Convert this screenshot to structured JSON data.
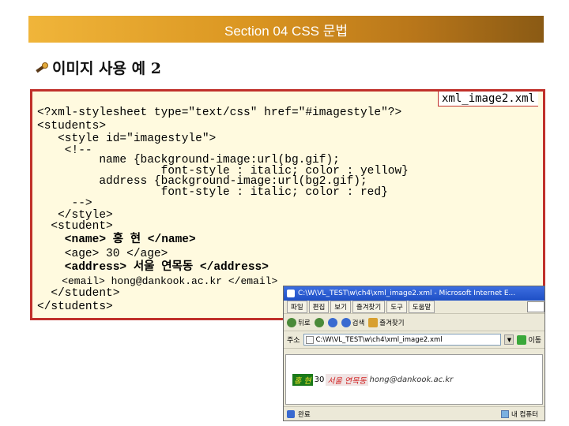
{
  "header": {
    "title": "Section 04 CSS 문법"
  },
  "slide": {
    "heading": "이미지 사용 예 2"
  },
  "code": {
    "filename": "xml_image2.xml",
    "lines": [
      "<?xml-stylesheet type=\"text/css\" href=\"#imagestyle\"?>",
      "<students>",
      "   <style id=\"imagestyle\">",
      "    <!--",
      "         name {background-image:url(bg.gif);",
      "                  font-style : italic; color : yellow}",
      "         address {background-image:url(bg2.gif);",
      "                  font-style : italic; color : red}",
      "     -->",
      "   </style>",
      "  <student>",
      "    <name> 홍 현 </name>",
      "    <age> 30 </age>",
      "    <address> 서울 연목동 </address>",
      "    <email> hong@dankook.ac.kr </email>",
      "  </student>",
      "</students>"
    ]
  },
  "browser": {
    "title": "C:\\W\\VL_TEST\\w\\ch4\\xml_image2.xml - Microsoft Internet E...",
    "menu": [
      "파일",
      "편집",
      "보기",
      "즐겨찾기",
      "도구",
      "도움말"
    ],
    "toolbar": [
      "뒤로",
      "검색",
      "즐겨찾기"
    ],
    "address_label": "주소",
    "address_value": "C:\\W\\VL_TEST\\w\\ch4\\xml_image2.xml",
    "go_label": "이동",
    "render": {
      "name": "홍 현",
      "age": "30",
      "address": "서울 연목동",
      "email": "hong@dankook.ac.kr"
    },
    "status": {
      "left": "완료",
      "zone": "내 컴퓨터"
    }
  }
}
